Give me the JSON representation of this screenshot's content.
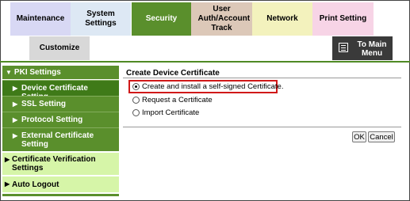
{
  "tabs": {
    "maintenance": "Maintenance",
    "system_settings": "System Settings",
    "security": "Security",
    "user_auth": "User Auth/Account Track",
    "network": "Network",
    "print_setting": "Print Setting",
    "customize": "Customize"
  },
  "to_main_menu": "To Main Menu",
  "sidebar": {
    "header": "PKI Settings",
    "items": [
      "Device Certificate Setting",
      "SSL Setting",
      "Protocol Setting",
      "External Certificate Setting"
    ],
    "other": [
      "Certificate Verification Settings",
      "Auto Logout"
    ]
  },
  "main": {
    "title": "Create Device Certificate",
    "options": [
      "Create and install a self-signed Certificate.",
      "Request a Certificate",
      "Import Certificate"
    ],
    "selected_option": "Create and install a self-signed Certificate.",
    "ok_label": "OK",
    "cancel_label": "Cancel"
  },
  "colors": {
    "accent_green": "#5a8f2c",
    "highlight_red": "#d01818"
  }
}
